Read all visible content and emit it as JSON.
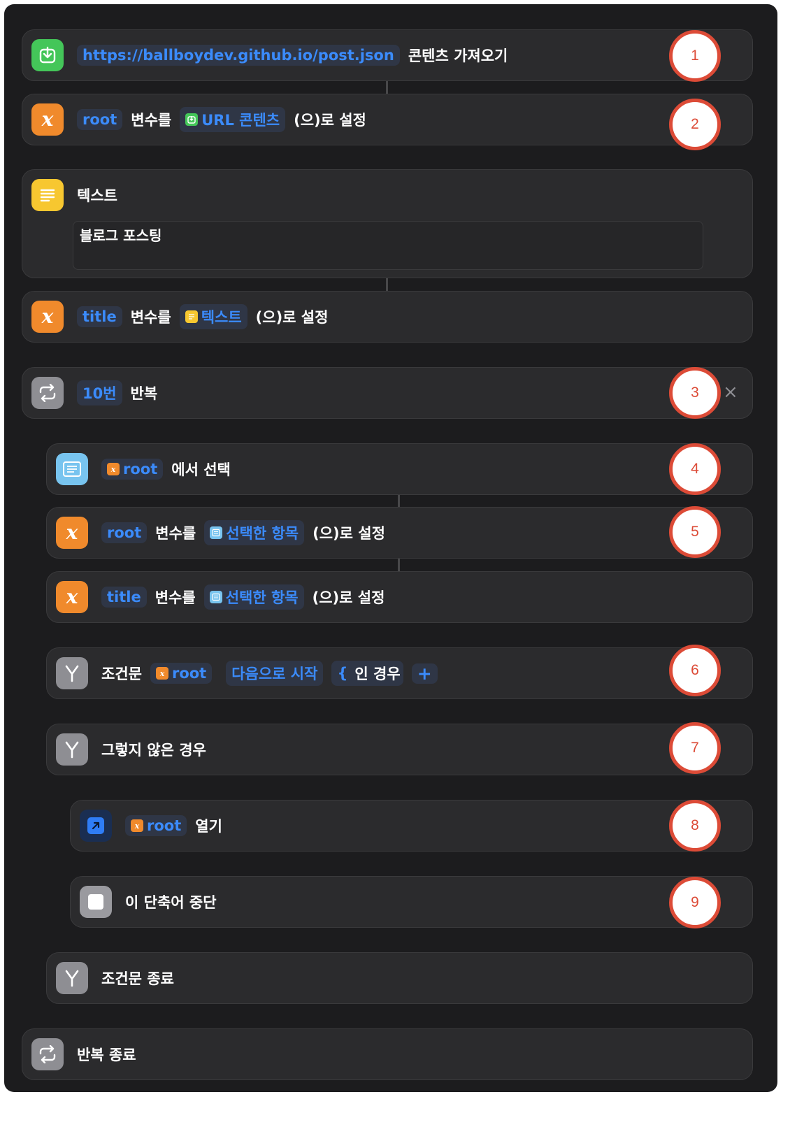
{
  "actions": {
    "fetch": {
      "url": "https://ballboydev.github.io/post.json",
      "label": "콘텐츠 가져오기"
    },
    "set_root": {
      "var": "root",
      "mid": "변수를",
      "value": "URL 콘텐츠",
      "suffix": "(으)로 설정"
    },
    "text": {
      "title": "텍스트",
      "body": "블로그 포스팅"
    },
    "set_title": {
      "var": "title",
      "mid": "변수를",
      "value": "텍스트",
      "suffix": "(으)로 설정"
    },
    "repeat": {
      "count": "10번",
      "label": "반복",
      "close": "×"
    },
    "choose": {
      "var": "root",
      "label": "에서 선택"
    },
    "set_root2": {
      "var": "root",
      "mid": "변수를",
      "value": "선택한 항목",
      "suffix": "(으)로 설정"
    },
    "set_title2": {
      "var": "title",
      "mid": "변수를",
      "value": "선택한 항목",
      "suffix": "(으)로 설정"
    },
    "if": {
      "label": "조건문",
      "var": "root",
      "cond": "다음으로 시작",
      "brace": "{",
      "suffix": "인 경우",
      "plus": "+"
    },
    "otherwise": {
      "label": "그렇지 않은 경우"
    },
    "open": {
      "var": "root",
      "label": "열기"
    },
    "stop": {
      "label": "이 단축어 중단"
    },
    "endif": {
      "label": "조건문 종료"
    },
    "endrepeat": {
      "label": "반복 종료"
    }
  },
  "badges": [
    "1",
    "2",
    "3",
    "4",
    "5",
    "6",
    "7",
    "8",
    "9"
  ]
}
